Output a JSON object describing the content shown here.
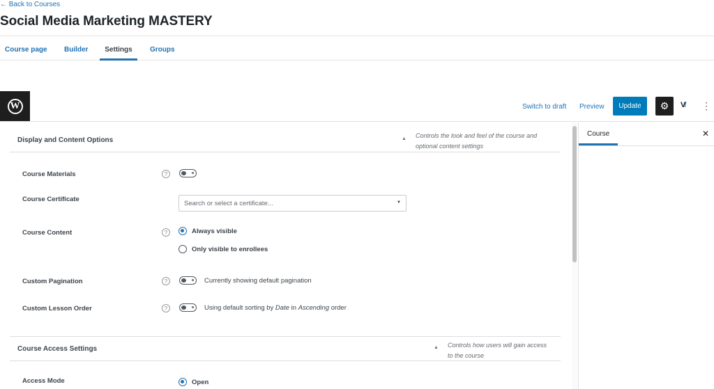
{
  "header": {
    "back_link": "← Back to Courses",
    "title": "Social Media Marketing MASTERY"
  },
  "tabs": [
    {
      "label": "Course page",
      "active": false
    },
    {
      "label": "Builder",
      "active": false
    },
    {
      "label": "Settings",
      "active": true
    },
    {
      "label": "Groups",
      "active": false
    }
  ],
  "toolbar": {
    "logo_glyph": "W",
    "switch_to_draft": "Switch to draft",
    "preview": "Preview",
    "update": "Update",
    "settings_glyph": "⚙",
    "vw_v": "V",
    "vw_w": "/",
    "more_glyph": "⋮"
  },
  "sections": {
    "display": {
      "title": "Display and Content Options",
      "caret": "▲",
      "description_line1": "Controls the look and feel of the course and",
      "description_line2": "optional content settings"
    },
    "access": {
      "title": "Course Access Settings",
      "caret": "▲",
      "description_line1": "Controls how users will gain access",
      "description_line2": "to the course"
    }
  },
  "settings": {
    "help_glyph": "?",
    "course_materials": {
      "label": "Course Materials",
      "enabled": false
    },
    "course_certificate": {
      "label": "Course Certificate",
      "placeholder": "Search or select a certificate...",
      "arrow": "▼"
    },
    "course_content": {
      "label": "Course Content",
      "options": [
        {
          "label": "Always visible",
          "selected": true
        },
        {
          "label": "Only visible to enrollees",
          "selected": false
        }
      ]
    },
    "custom_pagination": {
      "label": "Custom Pagination",
      "enabled": false,
      "text": "Currently showing default pagination"
    },
    "custom_lesson_order": {
      "label": "Custom Lesson Order",
      "enabled": false,
      "text_prefix": "Using default sorting by ",
      "text_em1": "Date",
      "text_mid": " in ",
      "text_em2": "Ascending",
      "text_suffix": " order"
    },
    "access_mode": {
      "label": "Access Mode",
      "options": [
        {
          "label": "Open",
          "selected": true
        }
      ]
    }
  },
  "sidebar": {
    "tab": "Course",
    "close_glyph": "✕"
  }
}
